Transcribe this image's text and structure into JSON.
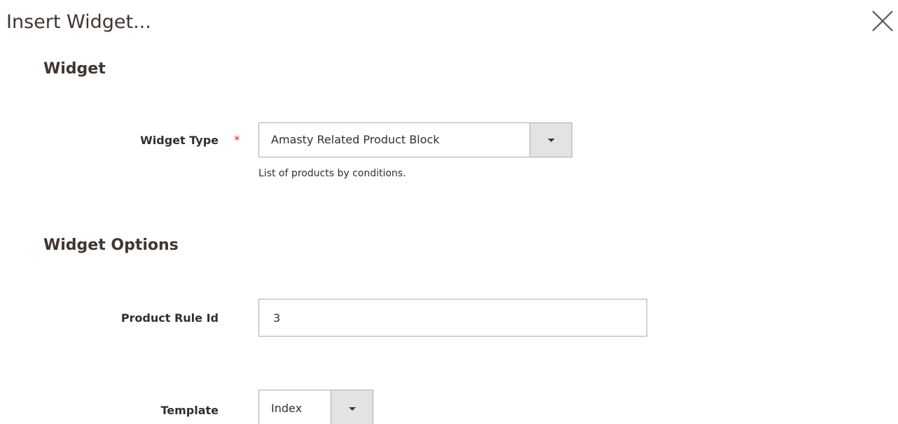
{
  "modal": {
    "title": "Insert Widget...",
    "close_icon": "close-icon"
  },
  "widget_section": {
    "title": "Widget",
    "widget_type": {
      "label": "Widget Type",
      "required_marker": "*",
      "selected": "Amasty Related Product Block",
      "note": "List of products by conditions."
    }
  },
  "options_section": {
    "title": "Widget Options",
    "product_rule_id": {
      "label": "Product Rule Id",
      "value": "3"
    },
    "template": {
      "label": "Template",
      "selected": "Index"
    }
  },
  "colors": {
    "required": "#e22626",
    "border": "#adadad",
    "select_arrow_bg": "#e3e3e3",
    "title_text": "#41362f"
  }
}
